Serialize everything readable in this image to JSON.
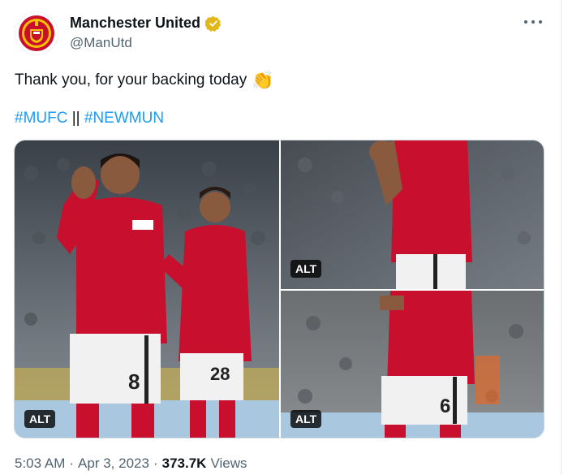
{
  "account": {
    "display_name": "Manchester United",
    "handle": "@ManUtd",
    "avatar_icon": "manchester-united-crest-icon",
    "verified_icon": "gold-verified-badge-icon",
    "menu_icon": "more-horizontal-icon"
  },
  "tweet": {
    "text": "Thank you, for your backing today",
    "emoji": "👏",
    "hashtags": [
      "#MUFC",
      "#NEWMUN"
    ],
    "hashtag_separator": "||"
  },
  "media": {
    "photos": [
      {
        "alt_label": "ALT",
        "shirt_number": "8",
        "second_number": "28"
      },
      {
        "alt_label": "ALT"
      },
      {
        "alt_label": "ALT",
        "shirt_number": "6"
      }
    ]
  },
  "meta": {
    "time": "5:03 AM",
    "separator": "·",
    "date": "Apr 3, 2023",
    "views_count": "373.7K",
    "views_label": "Views"
  },
  "colors": {
    "accent": "#1d9bf0",
    "text": "#0f1419",
    "secondary_text": "#536471",
    "verified_gold": "#e2b719",
    "kit_red": "#c8102e"
  }
}
